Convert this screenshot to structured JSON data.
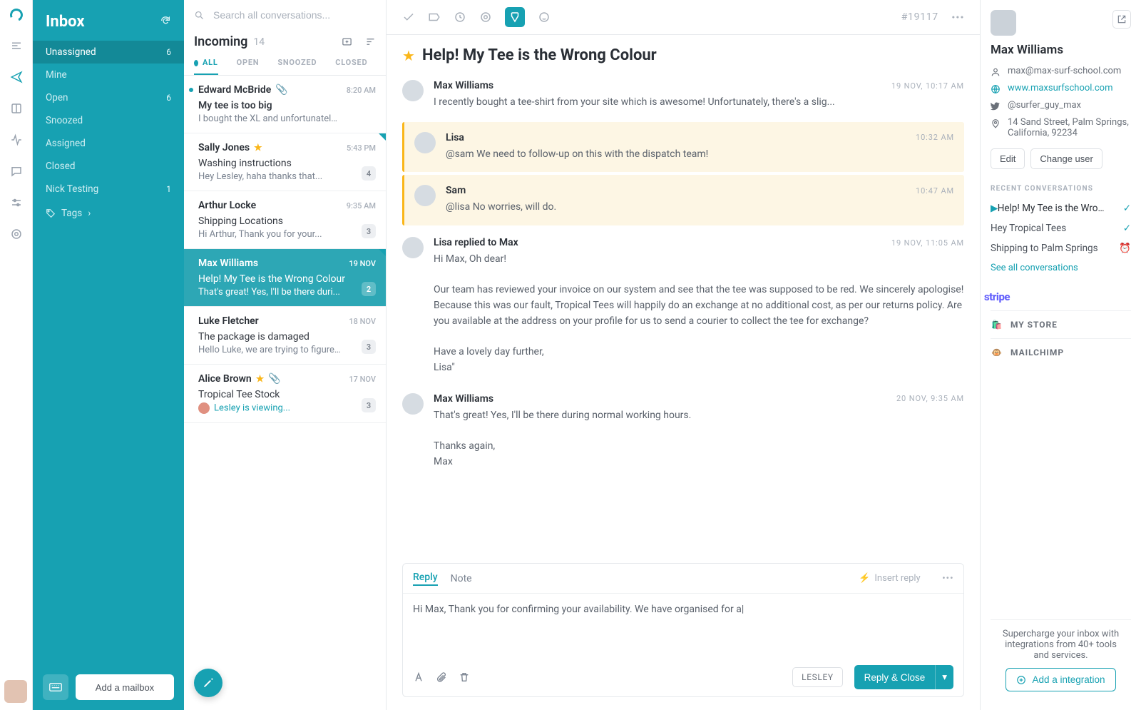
{
  "app": {
    "inbox_title": "Inbox"
  },
  "nav": {
    "folders": [
      {
        "label": "Unassigned",
        "count": "6"
      },
      {
        "label": "Mine",
        "count": ""
      },
      {
        "label": "Open",
        "count": "6"
      },
      {
        "label": "Snoozed",
        "count": ""
      },
      {
        "label": "Assigned",
        "count": ""
      },
      {
        "label": "Closed",
        "count": ""
      },
      {
        "label": "Nick Testing",
        "count": "1"
      }
    ],
    "tags_label": "Tags",
    "add_mailbox": "Add a mailbox"
  },
  "search": {
    "placeholder": "Search all conversations..."
  },
  "list": {
    "title": "Incoming",
    "count": "14",
    "tabs": [
      "ALL",
      "OPEN",
      "SNOOZED",
      "CLOSED"
    ],
    "items": [
      {
        "name": "Edward McBride",
        "date": "8:20 AM",
        "subject": "My tee is too big",
        "preview": "I bought the XL and unfortunately...",
        "unread": true,
        "badge": "",
        "star": false,
        "clip": true,
        "tri": false
      },
      {
        "name": "Sally Jones",
        "date": "5:43 PM",
        "subject": "Washing instructions",
        "preview": "Hey Lesley, haha thanks that...",
        "unread": false,
        "badge": "4",
        "star": true,
        "clip": false,
        "tri": true
      },
      {
        "name": "Arthur Locke",
        "date": "9:35 AM",
        "subject": "Shipping Locations",
        "preview": "Hi Arthur, Thank you for your...",
        "unread": false,
        "badge": "3",
        "star": false,
        "clip": false,
        "tri": false
      },
      {
        "name": "Max Williams",
        "date": "19 NOV",
        "subject": "Help! My Tee is the Wrong Colour",
        "preview": "That's great! Yes, I'll be there duri...",
        "unread": false,
        "badge": "2",
        "star": false,
        "clip": false,
        "tri": true
      },
      {
        "name": "Luke Fletcher",
        "date": "18 NOV",
        "subject": "The package is damaged",
        "preview": "Hello Luke, we are trying to figure...",
        "unread": false,
        "badge": "3",
        "star": false,
        "clip": false,
        "tri": false
      },
      {
        "name": "Alice Brown",
        "date": "17 NOV",
        "subject": "Tropical Tee Stock",
        "preview": "Lesley is viewing...",
        "unread": false,
        "badge": "3",
        "star": true,
        "clip": true,
        "tri": false,
        "viewing": true
      }
    ]
  },
  "thread": {
    "id": "#19117",
    "title": "Help! My Tee is the Wrong Colour",
    "messages": [
      {
        "who": "Max Williams",
        "when": "19 NOV, 10:17 AM",
        "text": "I recently bought a tee-shirt from your site which is awesome! Unfortunately, there's a slig..."
      },
      {
        "who": "Lisa",
        "when": "10:32 AM",
        "text": "@sam We need to follow-up on this with the dispatch team!",
        "note": true
      },
      {
        "who": "Sam",
        "when": "10:47 AM",
        "text": "@lisa No worries, will do.",
        "note": true
      },
      {
        "who": "Lisa replied to Max",
        "when": "19 NOV, 11:05 AM",
        "text": "Hi Max, Oh dear!\n\nOur team has reviewed your invoice on our system and see that the tee was supposed to be red. We sincerely apologise! Because this was our fault, Tropical Tees will happily do an exchange at no additional cost, as per our returns policy. Are you available at the address on your profile for us to send a courier to collect the tee for exchange?\n\nHave a lovely day further,\nLisa\""
      },
      {
        "who": "Max Williams",
        "when": "20 NOV, 9:35 AM",
        "text": "That's great! Yes, I'll be there during normal working hours.\n\nThanks again,\nMax"
      }
    ],
    "reply": {
      "tab_reply": "Reply",
      "tab_note": "Note",
      "insert": "Insert reply",
      "draft": "Hi Max, Thank you for confirming your availability. We have organised for a|",
      "signer": "LESLEY",
      "send": "Reply & Close"
    }
  },
  "customer": {
    "name": "Max Williams",
    "email": "max@max-surf-school.com",
    "site": "www.maxsurfschool.com",
    "twitter": "@surfer_guy_max",
    "address": "14 Sand Street, Palm Springs, California, 92234",
    "edit": "Edit",
    "change": "Change user",
    "recent_title": "RECENT CONVERSATIONS",
    "recent": [
      {
        "label": "Help! My Tee is the Wron...",
        "state": "check",
        "current": true
      },
      {
        "label": "Hey Tropical Tees",
        "state": "check"
      },
      {
        "label": "Shipping to Palm Springs",
        "state": "alarm"
      }
    ],
    "see_all": "See all conversations",
    "integrations": [
      {
        "label": "stripe",
        "kind": "stripe"
      },
      {
        "label": "MY STORE",
        "kind": "shopify"
      },
      {
        "label": "MAILCHIMP",
        "kind": "mailchimp"
      }
    ],
    "promo": "Supercharge your inbox with integrations from 40+ tools and services.",
    "add_int": "Add a integration"
  }
}
